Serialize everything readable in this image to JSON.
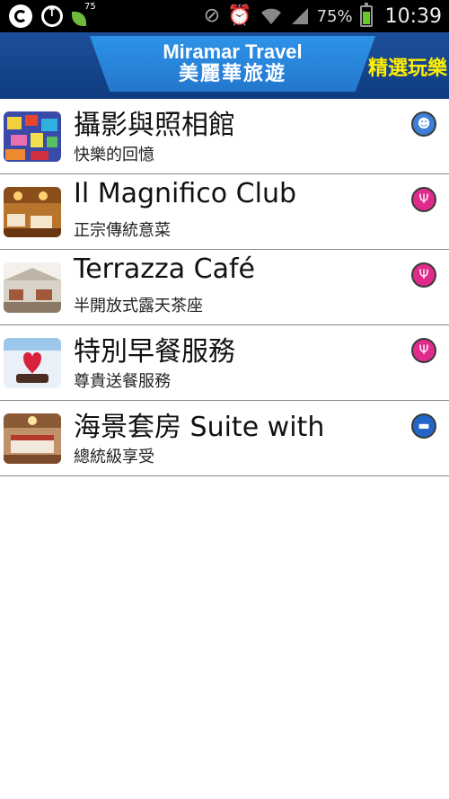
{
  "status_bar": {
    "notification_badge": "75",
    "battery_percent": "75%",
    "time": "10:39"
  },
  "header": {
    "brand_en": "Miramar Travel",
    "brand_zh": "美麗華旅遊",
    "title": "精選玩樂"
  },
  "items": [
    {
      "title": "攝影與照相館",
      "subtitle": "快樂的回憶",
      "category_icon": "theater-masks-icon"
    },
    {
      "title": "Il Magnifico Club",
      "subtitle": "正宗傳統意菜",
      "category_icon": "fork-knife-icon"
    },
    {
      "title": "Terrazza Café",
      "subtitle": "半開放式露天茶座",
      "category_icon": "fork-knife-icon"
    },
    {
      "title": "特別早餐服務",
      "subtitle": "尊貴送餐服務",
      "category_icon": "fork-knife-icon"
    },
    {
      "title": "海景套房 Suite with",
      "subtitle": "總統級享受",
      "category_icon": "bed-icon"
    }
  ]
}
